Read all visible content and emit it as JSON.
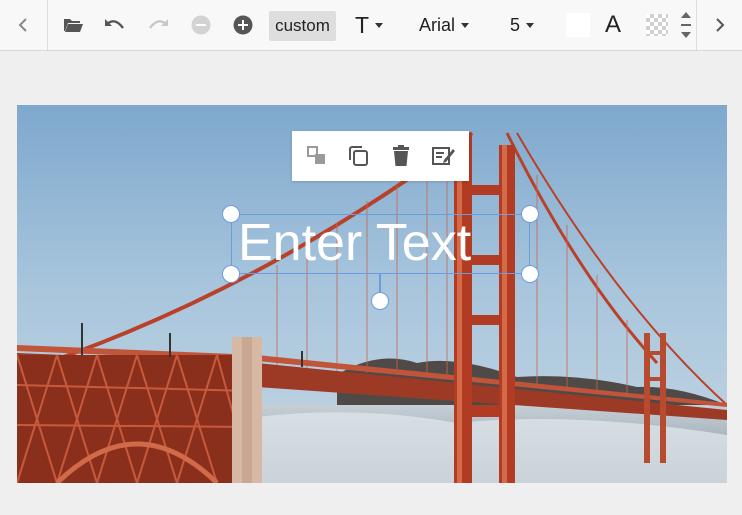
{
  "toolbar": {
    "zoom_preset": "custom",
    "font_family": "Arial",
    "font_size": "5",
    "text_tool_letter": "T",
    "text_color_letter": "A",
    "fill_color": "#ffffff",
    "nav_prev_icon": "chevron-left-icon",
    "nav_next_icon": "chevron-right-icon"
  },
  "canvas": {
    "overlay_text": "Enter Text",
    "selection_color": "#6d9be0"
  },
  "context_menu": {
    "items": [
      "arrange-icon",
      "duplicate-icon",
      "delete-icon",
      "edit-text-icon"
    ]
  }
}
